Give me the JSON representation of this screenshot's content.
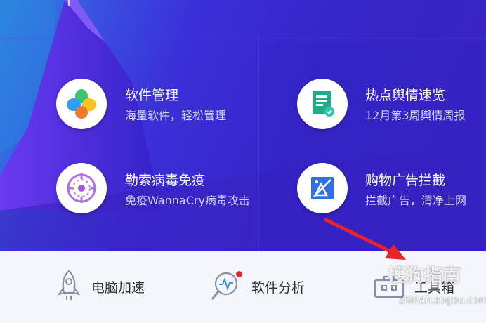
{
  "tiles": [
    {
      "title": "软件管理",
      "subtitle": "海量软件，轻松管理",
      "icon": "clover-app-icon"
    },
    {
      "title": "热点舆情速览",
      "subtitle": "12月第3周舆情周报",
      "icon": "report-document-icon"
    },
    {
      "title": "勒索病毒免疫",
      "subtitle": "免疫WannaCry病毒攻击",
      "icon": "virus-target-icon"
    },
    {
      "title": "购物广告拦截",
      "subtitle": "拦截广告，清净上网",
      "icon": "ad-block-icon"
    }
  ],
  "toolbar": {
    "speedup_label": "电脑加速",
    "analysis_label": "软件分析",
    "toolbox_label": "工具箱"
  },
  "watermark": {
    "brand": "搜狗指南",
    "url": "zhinan.sogou.com"
  },
  "colors": {
    "hero_bg": "#3a2fd8",
    "accent_red": "#e8232a",
    "notification_dot": "#e8232a"
  }
}
